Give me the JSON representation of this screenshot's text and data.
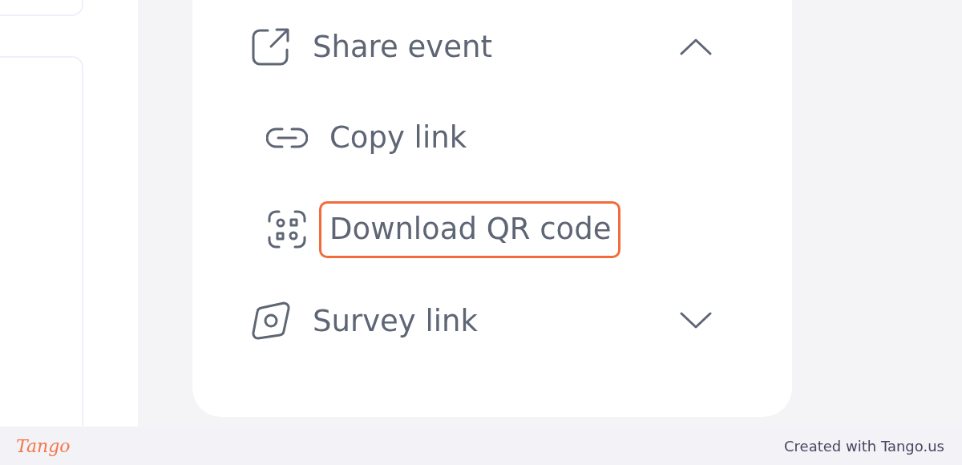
{
  "menu": {
    "sections": [
      {
        "label": "Share event",
        "kind": "share",
        "expanded": true,
        "items": [
          {
            "label": "Copy link",
            "kind": "link",
            "highlighted": false
          },
          {
            "label": "Download QR code",
            "kind": "qr",
            "highlighted": true
          }
        ]
      },
      {
        "label": "Survey link",
        "kind": "survey",
        "expanded": false
      }
    ]
  },
  "footer": {
    "logo": "Tango",
    "credit": "Created with Tango.us"
  }
}
